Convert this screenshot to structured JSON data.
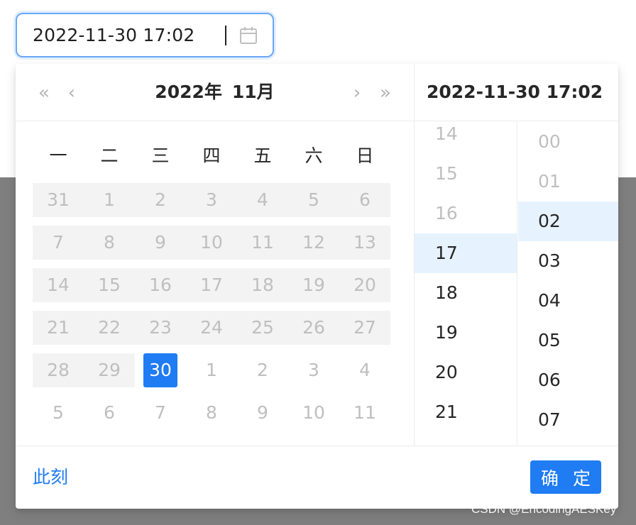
{
  "input": {
    "value": "2022-11-30 17:02"
  },
  "header": {
    "prev_year": "«",
    "prev_month": "‹",
    "year": "2022年",
    "month": "11月",
    "next_month": "›",
    "next_year": "»"
  },
  "weekdays": [
    "一",
    "二",
    "三",
    "四",
    "五",
    "六",
    "日"
  ],
  "weeks": [
    [
      "31",
      "1",
      "2",
      "3",
      "4",
      "5",
      "6"
    ],
    [
      "7",
      "8",
      "9",
      "10",
      "11",
      "12",
      "13"
    ],
    [
      "14",
      "15",
      "16",
      "17",
      "18",
      "19",
      "20"
    ],
    [
      "21",
      "22",
      "23",
      "24",
      "25",
      "26",
      "27"
    ],
    [
      "28",
      "29",
      "30",
      "1",
      "2",
      "3",
      "4"
    ],
    [
      "5",
      "6",
      "7",
      "8",
      "9",
      "10",
      "11"
    ]
  ],
  "selected_date": "30",
  "time_panel": {
    "selected_value": "2022-11-30 17:02",
    "hours": [
      "14",
      "15",
      "16",
      "17",
      "18",
      "19",
      "20",
      "21"
    ],
    "selected_hour": "17",
    "minutes": [
      "00",
      "01",
      "02",
      "03",
      "04",
      "05",
      "06",
      "07"
    ],
    "selected_minute": "02"
  },
  "footer": {
    "now_label": "此刻",
    "ok_label": "确 定"
  },
  "watermark": "CSDN @EncodingAESKey",
  "colors": {
    "accent": "#1f7cf2",
    "selected_time_bg": "#e6f3ff",
    "disabled_text": "#bfbfbf",
    "past_cell_bg": "#f3f3f3",
    "backdrop": "#7f7f7f"
  },
  "icons": {
    "input": "calendar-icon"
  }
}
